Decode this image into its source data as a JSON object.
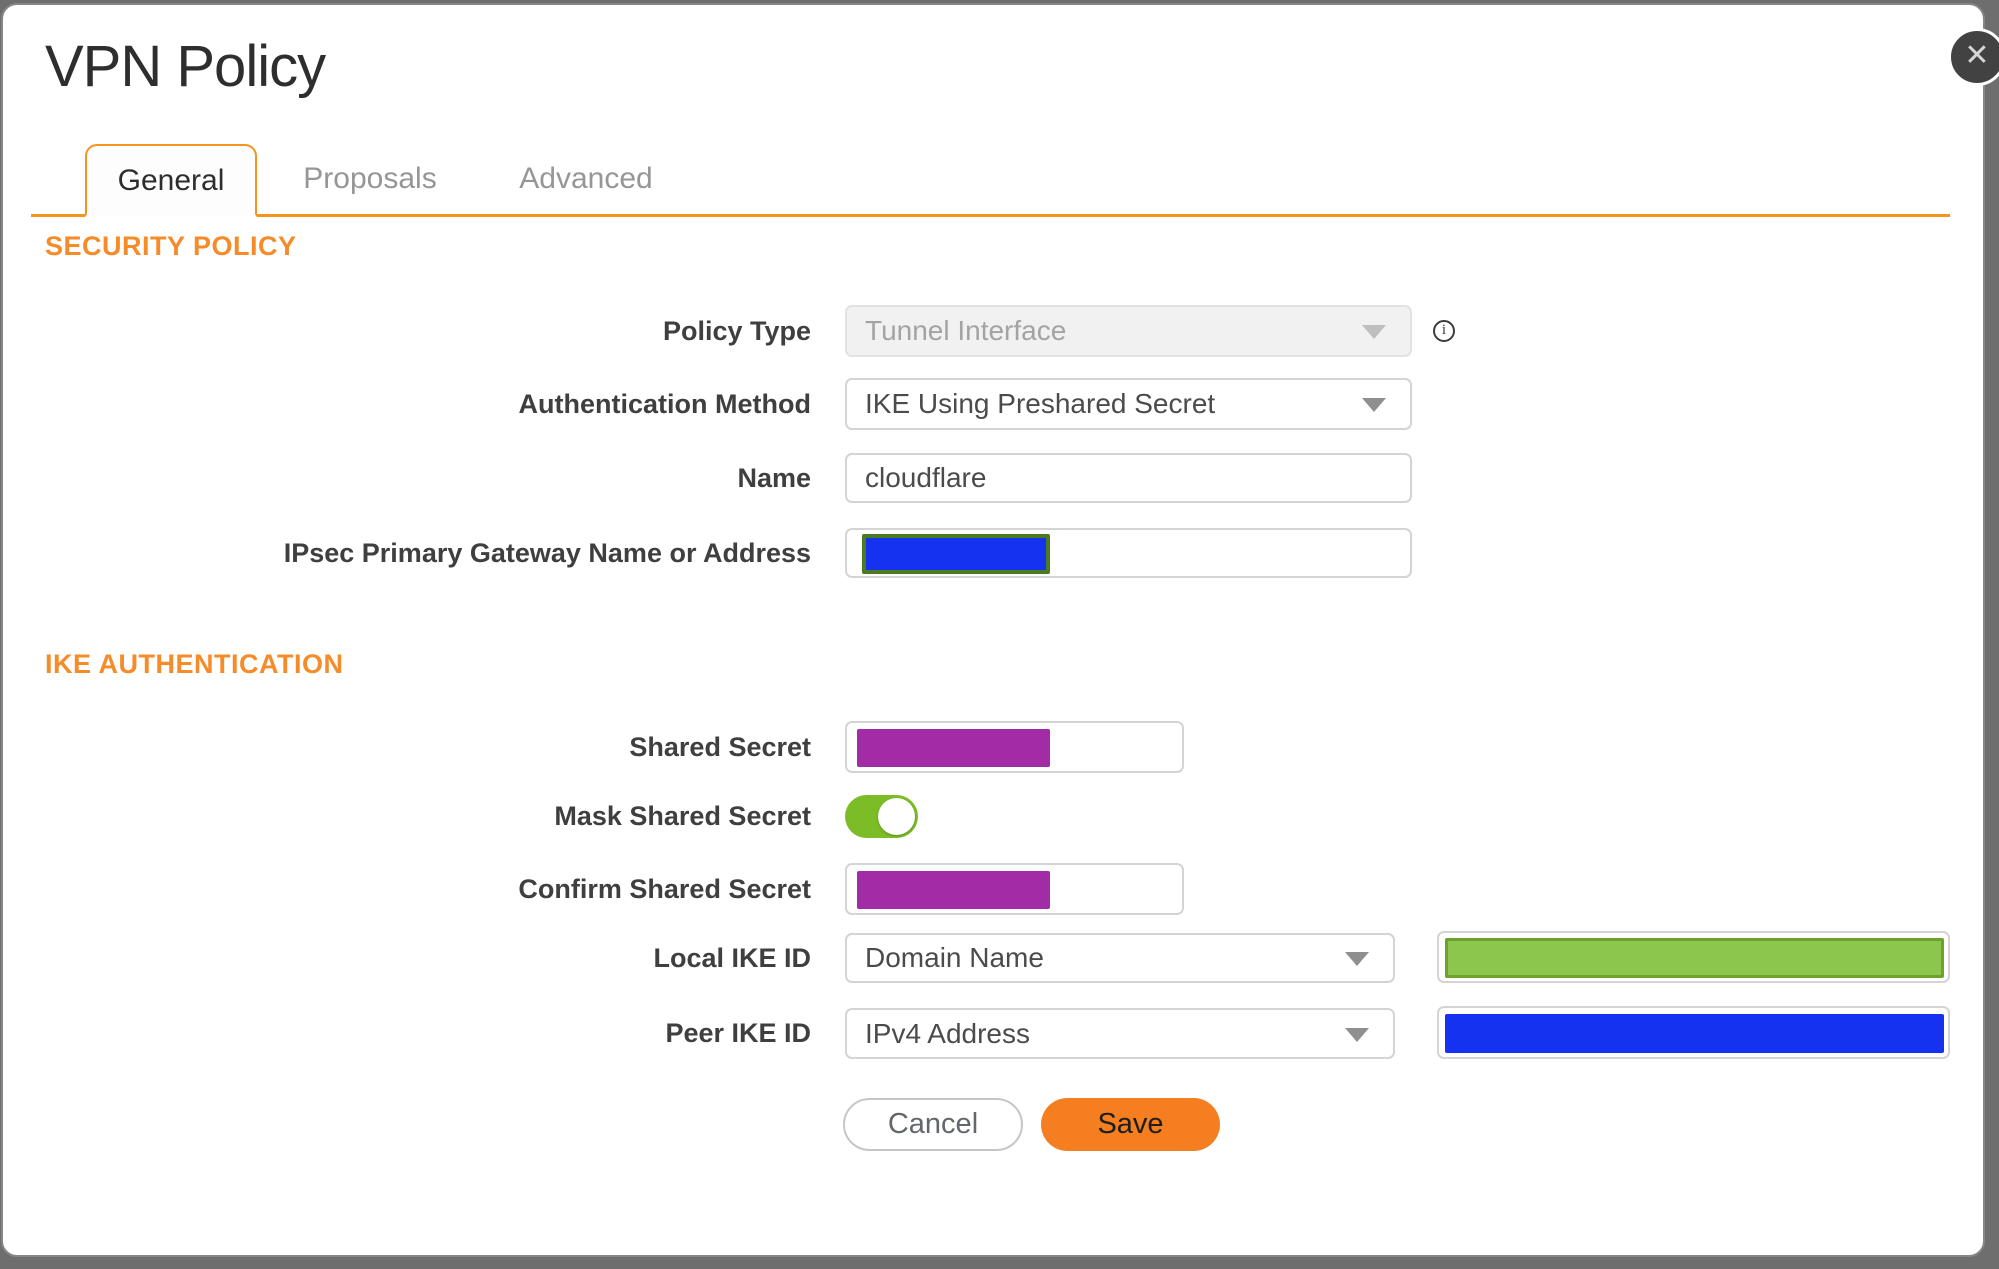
{
  "dialog": {
    "title": "VPN Policy",
    "tabs": [
      {
        "label": "General",
        "active": true
      },
      {
        "label": "Proposals",
        "active": false
      },
      {
        "label": "Advanced",
        "active": false
      }
    ],
    "sections": {
      "security_policy": "SECURITY POLICY",
      "ike_authentication": "IKE AUTHENTICATION"
    },
    "fields": {
      "policy_type": {
        "label": "Policy Type",
        "value": "Tunnel Interface",
        "disabled": true
      },
      "authentication_method": {
        "label": "Authentication Method",
        "value": "IKE Using Preshared Secret"
      },
      "name": {
        "label": "Name",
        "value": "cloudflare"
      },
      "gateway": {
        "label": "IPsec Primary Gateway Name or Address",
        "value": "",
        "redacted": true
      },
      "shared_secret": {
        "label": "Shared Secret",
        "value": "",
        "redacted": true
      },
      "mask_shared_secret": {
        "label": "Mask Shared Secret",
        "state": "on"
      },
      "confirm_shared_secret": {
        "label": "Confirm Shared Secret",
        "value": "",
        "redacted": true
      },
      "local_ike_id": {
        "label": "Local IKE ID",
        "value": "Domain Name",
        "id_value_redacted": true
      },
      "peer_ike_id": {
        "label": "Peer IKE ID",
        "value": "IPv4 Address",
        "id_value_redacted": true
      }
    },
    "buttons": {
      "cancel": "Cancel",
      "save": "Save"
    },
    "close_glyph": "✕",
    "info_glyph": "i",
    "colors": {
      "accent": "#F7941E",
      "heading": "#F68B2A",
      "save_bg": "#F57E20",
      "save_text": "#1D1D1B",
      "redact_blue": "#1532F0",
      "redact_purple": "#A12CA5",
      "redact_green": "#8CC64D",
      "redact_green_border": "#6BA32E",
      "gateway_box_border": "#4C7A21",
      "toggle_on": "#7CBC27",
      "backdrop": "#6E6E6E"
    }
  }
}
